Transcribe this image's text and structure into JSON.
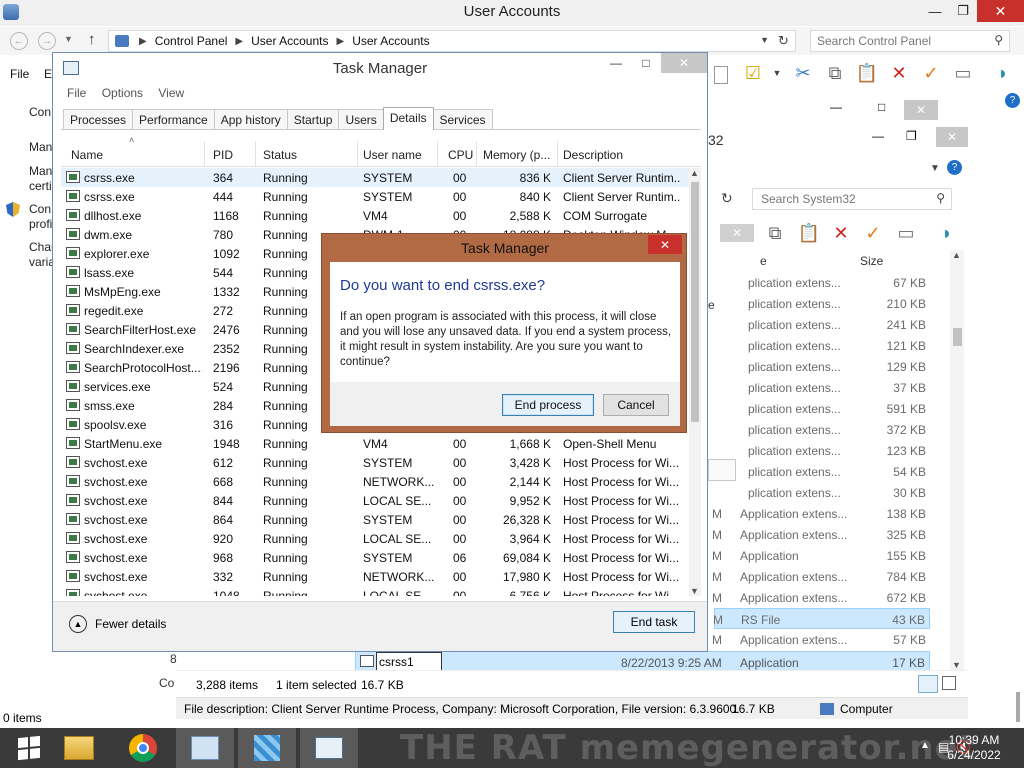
{
  "outer": {
    "title": "User Accounts",
    "breadcrumbs": [
      "Control Panel",
      "User Accounts",
      "User Accounts"
    ],
    "search_placeholder": "Search Control Panel",
    "menu": [
      "File",
      "Ec"
    ],
    "left_items": [
      "Con",
      "Man",
      "Man",
      "certi",
      "Con",
      "profi",
      "Char",
      "varia"
    ],
    "status_items": "0 items"
  },
  "explorer2": {
    "search_placeholder": "Search System32",
    "title_fragment": "32",
    "col_size": "Size",
    "col_type_fragment": "e",
    "rows": [
      {
        "date": "",
        "type": "plication extens...",
        "size": "67 KB"
      },
      {
        "date": "",
        "type": "plication extens...",
        "size": "210 KB"
      },
      {
        "date": "",
        "type": "plication extens...",
        "size": "241 KB"
      },
      {
        "date": "",
        "type": "plication extens...",
        "size": "121 KB"
      },
      {
        "date": "",
        "type": "plication extens...",
        "size": "129 KB"
      },
      {
        "date": "",
        "type": "plication extens...",
        "size": "37 KB"
      },
      {
        "date": "",
        "type": "plication extens...",
        "size": "591 KB"
      },
      {
        "date": "",
        "type": "plication extens...",
        "size": "372 KB"
      },
      {
        "date": "",
        "type": "plication extens...",
        "size": "123 KB"
      },
      {
        "date": "",
        "type": "plication extens...",
        "size": "54 KB"
      },
      {
        "date": "",
        "type": "plication extens...",
        "size": "30 KB"
      },
      {
        "date": "M",
        "type": "Application extens...",
        "size": "138 KB"
      },
      {
        "date": "M",
        "type": "Application extens...",
        "size": "325 KB"
      },
      {
        "date": "M",
        "type": "Application",
        "size": "155 KB"
      },
      {
        "date": "M",
        "type": "Application extens...",
        "size": "784 KB"
      },
      {
        "date": "M",
        "type": "Application extens...",
        "size": "672 KB"
      },
      {
        "date": "M",
        "type": "RS File",
        "size": "43 KB"
      },
      {
        "date": "M",
        "type": "Application extens...",
        "size": "57 KB"
      }
    ],
    "rename_value": "csrss1",
    "rename_date": "8/22/2013 9:25 AM",
    "rename_type": "Application",
    "rename_size": "17 KB",
    "left_frag_8": "8",
    "left_frag_co": "Co",
    "status_count": "3,288 items",
    "status_selected": "1 item selected",
    "status_size": "16.7 KB",
    "file_description": "File description: Client Server Runtime Process, Company: Microsoft Corporation, File version: 6.3.9600.",
    "file_desc_size": "16.7 KB",
    "computer_label": "Computer"
  },
  "taskmgr": {
    "title": "Task Manager",
    "menu": [
      "File",
      "Options",
      "View"
    ],
    "tabs": [
      "Processes",
      "Performance",
      "App history",
      "Startup",
      "Users",
      "Details",
      "Services"
    ],
    "active_tab": "Details",
    "columns": [
      "Name",
      "PID",
      "Status",
      "User name",
      "CPU",
      "Memory (p...",
      "Description"
    ],
    "rows": [
      {
        "name": "csrss.exe",
        "pid": "364",
        "status": "Running",
        "user": "SYSTEM",
        "cpu": "00",
        "mem": "836 K",
        "desc": "Client Server Runtim..."
      },
      {
        "name": "csrss.exe",
        "pid": "444",
        "status": "Running",
        "user": "SYSTEM",
        "cpu": "00",
        "mem": "840 K",
        "desc": "Client Server Runtim..."
      },
      {
        "name": "dllhost.exe",
        "pid": "1168",
        "status": "Running",
        "user": "VM4",
        "cpu": "00",
        "mem": "2,588 K",
        "desc": "COM Surrogate"
      },
      {
        "name": "dwm.exe",
        "pid": "780",
        "status": "Running",
        "user": "DWM-1",
        "cpu": "00",
        "mem": "18,088 K",
        "desc": "Desktop Window M..."
      },
      {
        "name": "explorer.exe",
        "pid": "1092",
        "status": "Running",
        "user": "",
        "cpu": "",
        "mem": "",
        "desc": ""
      },
      {
        "name": "lsass.exe",
        "pid": "544",
        "status": "Running",
        "user": "",
        "cpu": "",
        "mem": "",
        "desc": ""
      },
      {
        "name": "MsMpEng.exe",
        "pid": "1332",
        "status": "Running",
        "user": "",
        "cpu": "",
        "mem": "",
        "desc": ""
      },
      {
        "name": "regedit.exe",
        "pid": "272",
        "status": "Running",
        "user": "",
        "cpu": "",
        "mem": "",
        "desc": ""
      },
      {
        "name": "SearchFilterHost.exe",
        "pid": "2476",
        "status": "Running",
        "user": "",
        "cpu": "",
        "mem": "",
        "desc": ""
      },
      {
        "name": "SearchIndexer.exe",
        "pid": "2352",
        "status": "Running",
        "user": "",
        "cpu": "",
        "mem": "",
        "desc": ""
      },
      {
        "name": "SearchProtocolHost....",
        "pid": "2196",
        "status": "Running",
        "user": "",
        "cpu": "",
        "mem": "",
        "desc": ""
      },
      {
        "name": "services.exe",
        "pid": "524",
        "status": "Running",
        "user": "",
        "cpu": "",
        "mem": "",
        "desc": ""
      },
      {
        "name": "smss.exe",
        "pid": "284",
        "status": "Running",
        "user": "",
        "cpu": "",
        "mem": "",
        "desc": ""
      },
      {
        "name": "spoolsv.exe",
        "pid": "316",
        "status": "Running",
        "user": "",
        "cpu": "",
        "mem": "",
        "desc": ""
      },
      {
        "name": "StartMenu.exe",
        "pid": "1948",
        "status": "Running",
        "user": "VM4",
        "cpu": "00",
        "mem": "1,668 K",
        "desc": "Open-Shell Menu"
      },
      {
        "name": "svchost.exe",
        "pid": "612",
        "status": "Running",
        "user": "SYSTEM",
        "cpu": "00",
        "mem": "3,428 K",
        "desc": "Host Process for Wi..."
      },
      {
        "name": "svchost.exe",
        "pid": "668",
        "status": "Running",
        "user": "NETWORK...",
        "cpu": "00",
        "mem": "2,144 K",
        "desc": "Host Process for Wi..."
      },
      {
        "name": "svchost.exe",
        "pid": "844",
        "status": "Running",
        "user": "LOCAL SE...",
        "cpu": "00",
        "mem": "9,952 K",
        "desc": "Host Process for Wi..."
      },
      {
        "name": "svchost.exe",
        "pid": "864",
        "status": "Running",
        "user": "SYSTEM",
        "cpu": "00",
        "mem": "26,328 K",
        "desc": "Host Process for Wi..."
      },
      {
        "name": "svchost.exe",
        "pid": "920",
        "status": "Running",
        "user": "LOCAL SE...",
        "cpu": "00",
        "mem": "3,964 K",
        "desc": "Host Process for Wi..."
      },
      {
        "name": "svchost.exe",
        "pid": "968",
        "status": "Running",
        "user": "SYSTEM",
        "cpu": "06",
        "mem": "69,084 K",
        "desc": "Host Process for Wi..."
      },
      {
        "name": "svchost.exe",
        "pid": "332",
        "status": "Running",
        "user": "NETWORK...",
        "cpu": "00",
        "mem": "17,980 K",
        "desc": "Host Process for Wi..."
      },
      {
        "name": "svchost.exe",
        "pid": "1048",
        "status": "Running",
        "user": "LOCAL SE...",
        "cpu": "00",
        "mem": "6,756 K",
        "desc": "Host Process for Wi..."
      }
    ],
    "fewer_details": "Fewer details",
    "end_task": "End task"
  },
  "dialog": {
    "title": "Task Manager",
    "question": "Do you want to end csrss.exe?",
    "message": "If an open program is associated with this process, it will close and you will lose any unsaved data. If you end a system process, it might result in system instability. Are you sure you want to continue?",
    "confirm": "End process",
    "cancel": "Cancel"
  },
  "taskbar": {
    "time": "10:39 AM",
    "date": "6/24/2022",
    "watermark": "THE RAT  memegenerator.net"
  },
  "colors": {
    "dialog_frame": "#b26a45",
    "question_blue": "#1f3a93",
    "close_red": "#c7302b",
    "selection": "#cce8ff",
    "taskbar": "#3a3a3a"
  }
}
